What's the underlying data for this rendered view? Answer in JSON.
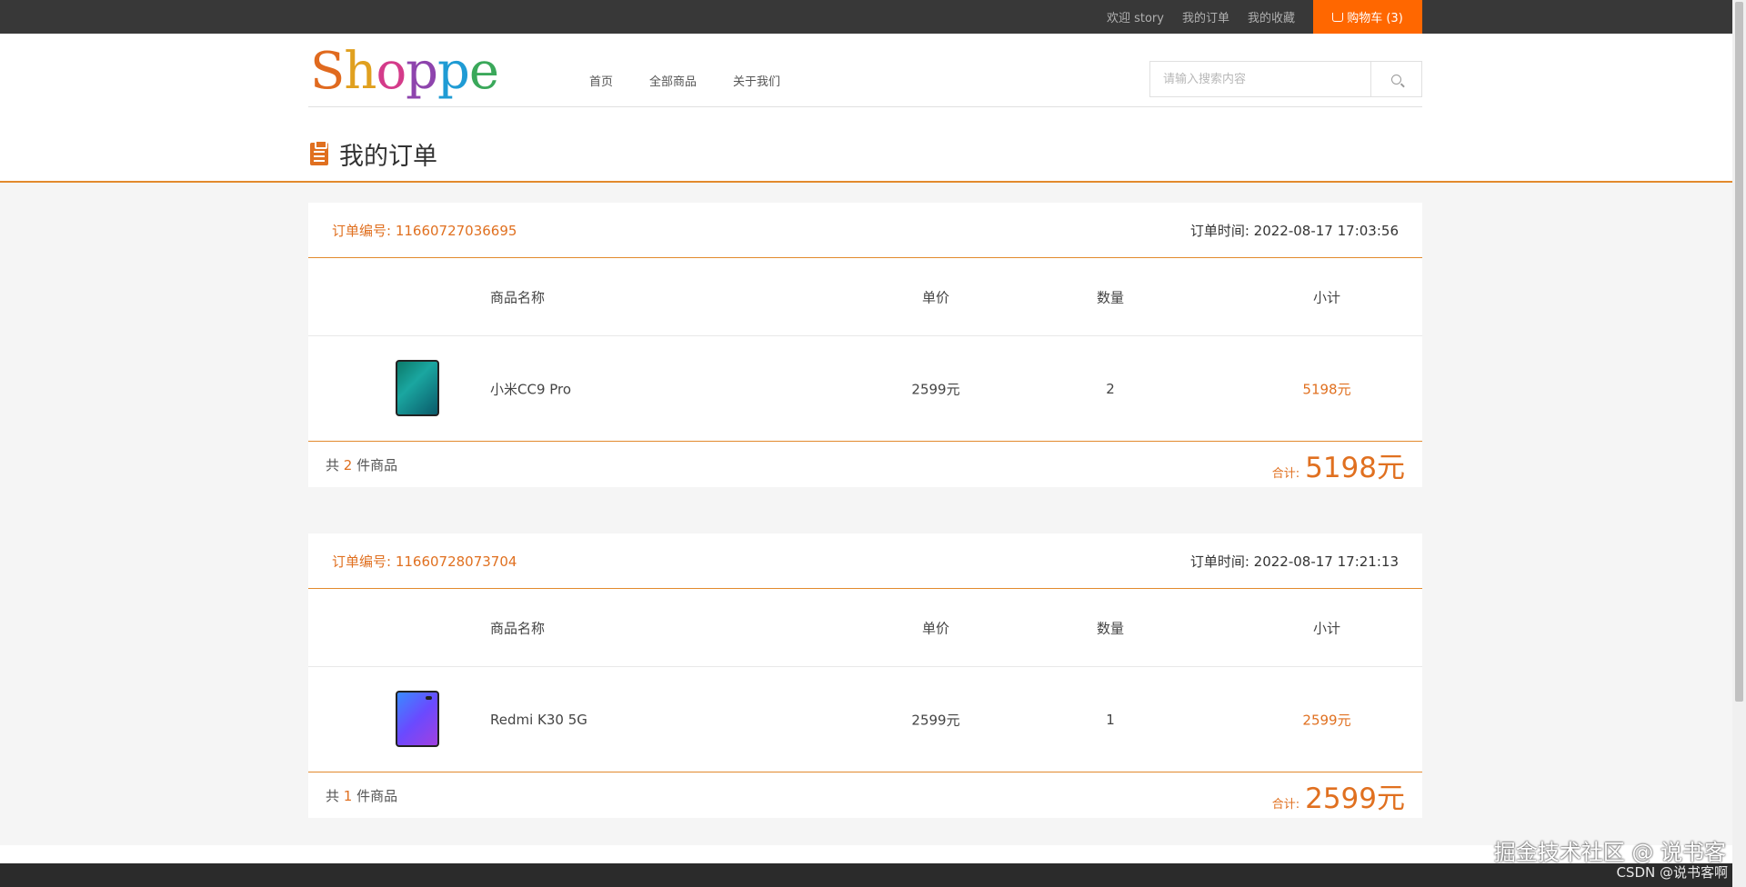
{
  "topbar": {
    "welcome": "欢迎 story",
    "orders": "我的订单",
    "favorites": "我的收藏",
    "cart": "购物车 (3)"
  },
  "header": {
    "logo": [
      "S",
      "h",
      "o",
      "p",
      "p",
      "e"
    ],
    "nav": [
      "首页",
      "全部商品",
      "关于我们"
    ],
    "search_placeholder": "请输入搜索内容"
  },
  "page": {
    "title": "我的订单"
  },
  "table_headers": {
    "name": "商品名称",
    "price": "单价",
    "qty": "数量",
    "subtotal": "小计"
  },
  "orders": [
    {
      "order_no": "订单编号: 11660727036695",
      "time": "订单时间: 2022-08-17 17:03:56",
      "items": [
        {
          "name": "小米CC9 Pro",
          "price": "2599元",
          "qty": "2",
          "subtotal": "5198元"
        }
      ],
      "count_prefix": "共",
      "count": "2",
      "count_suffix": "件商品",
      "total_label": "合计:",
      "total": "5198元"
    },
    {
      "order_no": "订单编号: 11660728073704",
      "time": "订单时间: 2022-08-17 17:21:13",
      "items": [
        {
          "name": "Redmi K30 5G",
          "price": "2599元",
          "qty": "1",
          "subtotal": "2599元"
        }
      ],
      "count_prefix": "共",
      "count": "1",
      "count_suffix": "件商品",
      "total_label": "合计:",
      "total": "2599元"
    }
  ],
  "watermark": {
    "line1": "掘金技术社区 @ 说书客",
    "line2": "CSDN @说书客啊"
  },
  "colors": {
    "accent": "#ff6700",
    "order_orange": "#e07020",
    "topbar": "#383838"
  }
}
